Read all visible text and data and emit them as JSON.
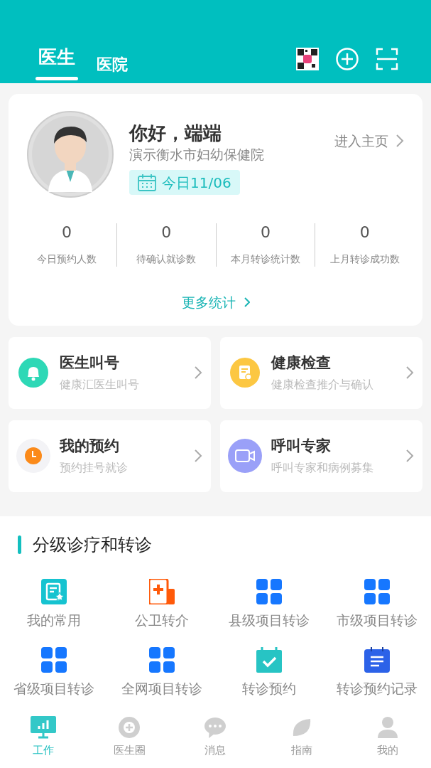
{
  "tabs": [
    {
      "label": "医生",
      "selected": true
    },
    {
      "label": "医院",
      "selected": false
    }
  ],
  "profile": {
    "greeting": "你好，端端",
    "hospital": "演示衡水市妇幼保健院",
    "homepage_link": "进入主页",
    "date_badge": "今日11/06"
  },
  "stats": [
    {
      "value": "0",
      "label": "今日预约人数"
    },
    {
      "value": "0",
      "label": "待确认就诊数"
    },
    {
      "value": "0",
      "label": "本月转诊统计数"
    },
    {
      "value": "0",
      "label": "上月转诊成功数"
    }
  ],
  "more_stats": "更多统计",
  "quick_cards": [
    {
      "kind": "bell",
      "title": "医生叫号",
      "subtitle": "健康汇医生叫号"
    },
    {
      "kind": "report",
      "title": "健康检查",
      "subtitle": "健康检查推介与确认"
    },
    {
      "kind": "clock",
      "title": "我的预约",
      "subtitle": "预约挂号就诊"
    },
    {
      "kind": "video",
      "title": "呼叫专家",
      "subtitle": "呼叫专家和病例募集"
    }
  ],
  "section": {
    "title": "分级诊疗和转诊",
    "items": [
      {
        "kind": "favorite",
        "label": "我的常用"
      },
      {
        "kind": "medical",
        "label": "公卫转介"
      },
      {
        "kind": "grid",
        "label": "县级项目转诊"
      },
      {
        "kind": "grid",
        "label": "市级项目转诊"
      },
      {
        "kind": "grid",
        "label": "省级项目转诊"
      },
      {
        "kind": "grid",
        "label": "全网项目转诊"
      },
      {
        "kind": "calendar",
        "label": "转诊预约"
      },
      {
        "kind": "notes",
        "label": "转诊预约记录"
      }
    ]
  },
  "bottom_nav": [
    {
      "kind": "monitor",
      "label": "工作",
      "selected": true
    },
    {
      "kind": "circle-plus",
      "label": "医生圈",
      "selected": false
    },
    {
      "kind": "chat",
      "label": "消息",
      "selected": false
    },
    {
      "kind": "leaf",
      "label": "指南",
      "selected": false
    },
    {
      "kind": "person",
      "label": "我的",
      "selected": false
    }
  ]
}
